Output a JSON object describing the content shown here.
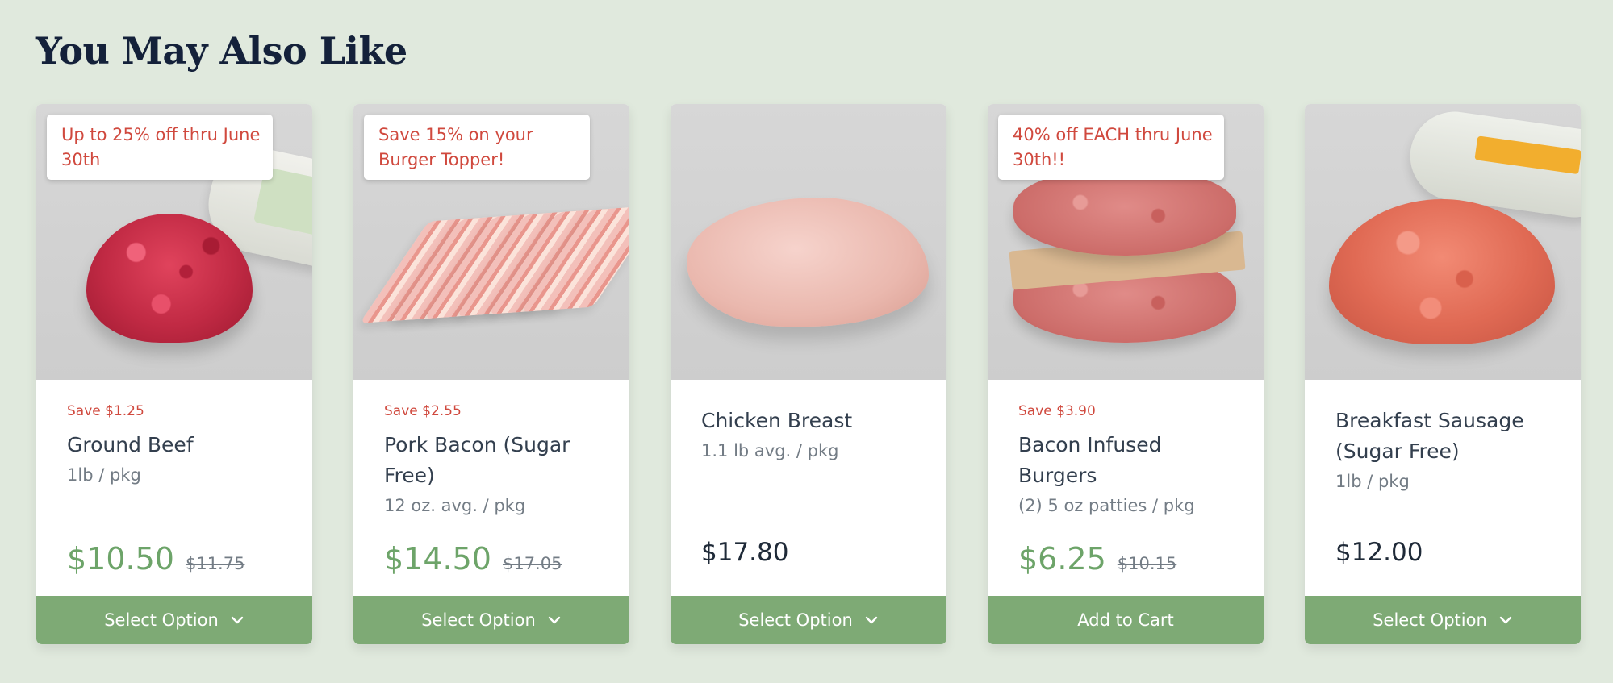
{
  "section": {
    "title": "You May Also Like"
  },
  "colors": {
    "background": "#e0e9dd",
    "accent_green": "#7eaa75",
    "sale_price_green": "#6da469",
    "promo_red": "#d0493e",
    "heading_navy": "#14213a"
  },
  "products": [
    {
      "promo": "Up to 25% off thru June 30th",
      "save": "Save $1.25",
      "name": "Ground Beef",
      "size": "1lb / pkg",
      "price": "$10.50",
      "was_price": "$11.75",
      "cta": "Select Option",
      "cta_icon": "chevron-down-icon",
      "image": "ground-beef-image"
    },
    {
      "promo": "Save 15% on your Burger Topper!",
      "save": "Save $2.55",
      "name": "Pork Bacon (Sugar Free)",
      "size": "12 oz. avg. / pkg",
      "price": "$14.50",
      "was_price": "$17.05",
      "cta": "Select Option",
      "cta_icon": "chevron-down-icon",
      "image": "pork-bacon-image"
    },
    {
      "promo": "",
      "save": "",
      "name": "Chicken Breast",
      "size": "1.1 lb avg. / pkg",
      "price": "$17.80",
      "was_price": "",
      "cta": "Select Option",
      "cta_icon": "chevron-down-icon",
      "image": "chicken-breast-image"
    },
    {
      "promo": "40% off EACH thru June 30th!!",
      "save": "Save $3.90",
      "name": "Bacon Infused Burgers",
      "size": "(2) 5 oz patties / pkg",
      "price": "$6.25",
      "was_price": "$10.15",
      "cta": "Add to Cart",
      "cta_icon": "",
      "image": "bacon-infused-burgers-image"
    },
    {
      "promo": "",
      "save": "",
      "name": "Breakfast Sausage (Sugar Free)",
      "size": "1lb / pkg",
      "price": "$12.00",
      "was_price": "",
      "cta": "Select Option",
      "cta_icon": "chevron-down-icon",
      "image": "breakfast-sausage-image"
    }
  ]
}
